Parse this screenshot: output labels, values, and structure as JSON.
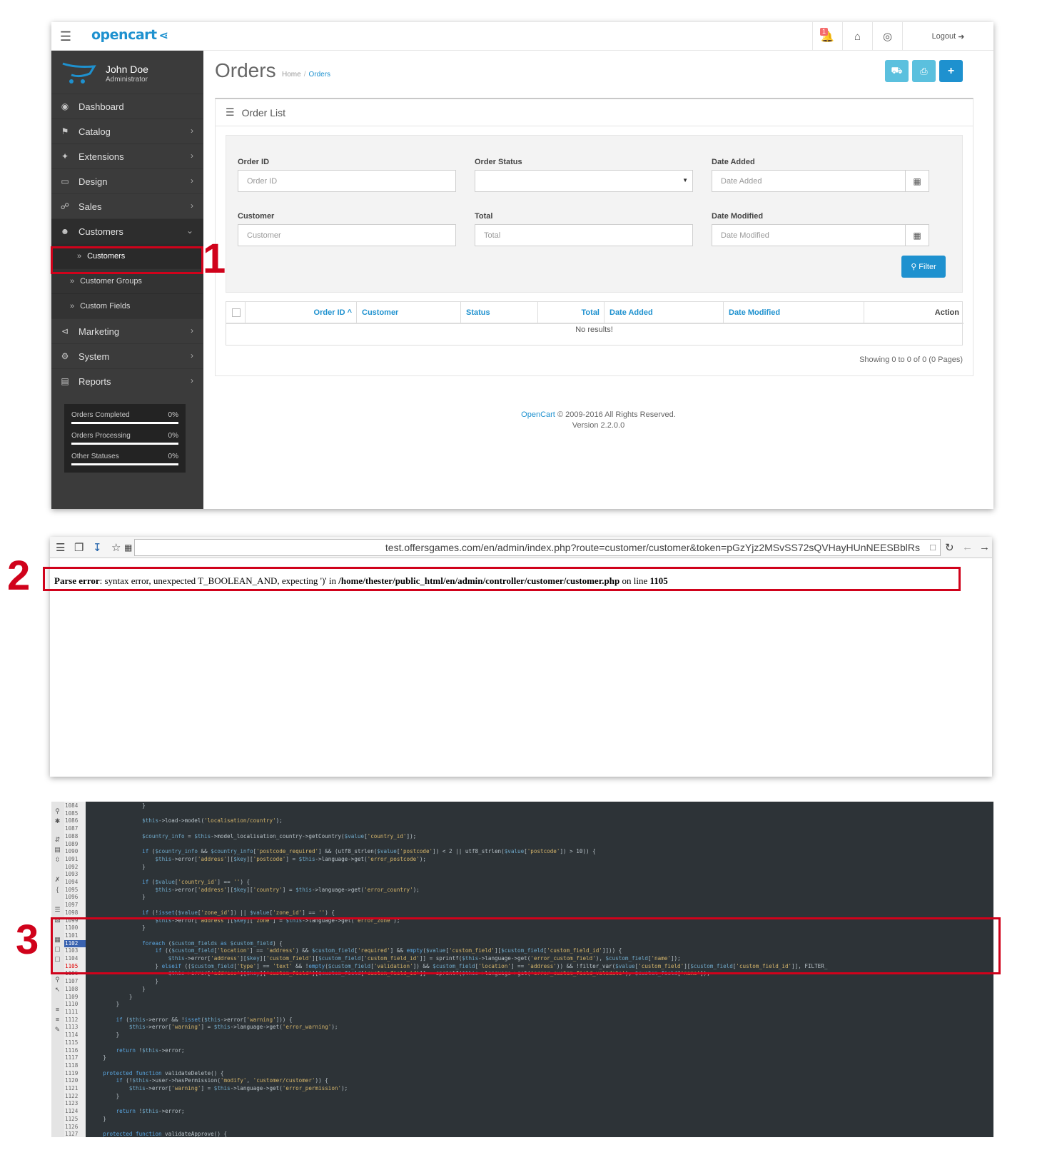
{
  "colors": {
    "brand": "#1e91cf",
    "sidebar_bg": "#3b3b3b",
    "highlight_red": "#d0021b",
    "btn_info": "#5bc0de",
    "editor_bg": "#2d3337"
  },
  "annotations": {
    "one": "1",
    "two": "2",
    "three": "3"
  },
  "opencart": {
    "logo": "opencart",
    "header": {
      "notification_count": "1",
      "logout_label": "Logout"
    },
    "profile": {
      "name": "John Doe",
      "role": "Administrator"
    },
    "nav": [
      {
        "label": "Dashboard",
        "icon": "dashboard-icon"
      },
      {
        "label": "Catalog",
        "icon": "tag-icon"
      },
      {
        "label": "Extensions",
        "icon": "puzzle-icon"
      },
      {
        "label": "Design",
        "icon": "monitor-icon"
      },
      {
        "label": "Sales",
        "icon": "cart-icon"
      },
      {
        "label": "Customers",
        "icon": "user-icon"
      },
      {
        "label": "Marketing",
        "icon": "share-icon"
      },
      {
        "label": "System",
        "icon": "cog-icon"
      },
      {
        "label": "Reports",
        "icon": "bar-chart-icon"
      }
    ],
    "subnav": [
      "Customers",
      "Customer Groups",
      "Custom Fields"
    ],
    "stats": [
      {
        "label": "Orders Completed",
        "value": "0%"
      },
      {
        "label": "Orders Processing",
        "value": "0%"
      },
      {
        "label": "Other Statuses",
        "value": "0%"
      }
    ],
    "page_title": "Orders",
    "breadcrumb": {
      "home": "Home",
      "current": "Orders"
    },
    "card_title": "Order List",
    "filters": {
      "order_id": {
        "label": "Order ID",
        "placeholder": "Order ID"
      },
      "order_status": {
        "label": "Order Status",
        "value": ""
      },
      "date_added": {
        "label": "Date Added",
        "placeholder": "Date Added"
      },
      "customer": {
        "label": "Customer",
        "placeholder": "Customer"
      },
      "total": {
        "label": "Total",
        "placeholder": "Total"
      },
      "date_modified": {
        "label": "Date Modified",
        "placeholder": "Date Modified"
      },
      "filter_button": "Filter"
    },
    "table": {
      "columns": [
        "Order ID",
        "Customer",
        "Status",
        "Total",
        "Date Added",
        "Date Modified",
        "Action"
      ],
      "sort_indicator": "^",
      "empty": "No results!"
    },
    "pagination": "Showing 0 to 0 of 0 (0 Pages)",
    "footer": {
      "link": "OpenCart",
      "copyright": "© 2009-2016 All Rights Reserved.",
      "version": "Version 2.2.0.0"
    }
  },
  "browser": {
    "url": "test.offersgames.com/en/admin/index.php?route=customer/customer&token=pGzYjz2MSvSS72sQVHayHUnNEESBblRs",
    "error": {
      "label": "Parse error",
      "message": ": syntax error, unexpected T_BOOLEAN_AND, expecting ')' in ",
      "path": "/home/thester/public_html/en/admin/controller/customer/customer.php",
      "on_line": " on line ",
      "line": "1105"
    }
  },
  "editor": {
    "line_numbers": [
      "1084",
      "1085",
      "1086",
      "1087",
      "1088",
      "1089",
      "1090",
      "1091",
      "1092",
      "1093",
      "1094",
      "1095",
      "1096",
      "1097",
      "1098",
      "1099",
      "1100",
      "1101",
      "1102",
      "1103",
      "1104",
      "1105",
      "1106",
      "1107",
      "1108",
      "1109",
      "1110",
      "1111",
      "1112",
      "1113",
      "1114",
      "1115",
      "1116",
      "1117",
      "1118",
      "1119",
      "1120",
      "1121",
      "1122",
      "1123",
      "1124",
      "1125",
      "1126",
      "1127"
    ],
    "current_line": "1102",
    "error_line": "1105",
    "lines": [
      "                }",
      "",
      "                $this->load->model('localisation/country');",
      "",
      "                $country_info = $this->model_localisation_country->getCountry($value['country_id']);",
      "",
      "                if ($country_info && $country_info['postcode_required'] && (utf8_strlen($value['postcode']) < 2 || utf8_strlen($value['postcode']) > 10)) {",
      "                    $this->error['address'][$key]['postcode'] = $this->language->get('error_postcode');",
      "                }",
      "",
      "                if ($value['country_id'] == '') {",
      "                    $this->error['address'][$key]['country'] = $this->language->get('error_country');",
      "                }",
      "",
      "                if (!isset($value['zone_id']) || $value['zone_id'] == '') {",
      "                    $this->error['address'][$key]['zone'] = $this->language->get('error_zone');",
      "                }",
      "",
      "                foreach ($custom_fields as $custom_field) {",
      "                    if (($custom_field['location'] == 'address') && $custom_field['required'] && empty($value['custom_field'][$custom_field['custom_field_id']])) {",
      "                        $this->error['address'][$key]['custom_field'][$custom_field['custom_field_id']] = sprintf($this->language->get('error_custom_field'), $custom_field['name']);",
      "                    } elseif (($custom_field['type'] == 'text' && !empty($custom_field['validation']) && $custom_field['location'] == 'address')) && !filter_var($value['custom_field'][$custom_field['custom_field_id']], FILTER_",
      "                        $this->error['address'][$key]['custom_field'][$custom_field['custom_field_id']] = sprintf($this->language->get('error_custom_field_validate'), $custom_field['name']);",
      "                    }",
      "                }",
      "            }",
      "        }",
      "",
      "        if ($this->error && !isset($this->error['warning'])) {",
      "            $this->error['warning'] = $this->language->get('error_warning');",
      "        }",
      "",
      "        return !$this->error;",
      "    }",
      "",
      "    protected function validateDelete() {",
      "        if (!$this->user->hasPermission('modify', 'customer/customer')) {",
      "            $this->error['warning'] = $this->language->get('error_permission');",
      "        }",
      "",
      "        return !$this->error;",
      "    }",
      "",
      "    protected function validateApprove() {"
    ]
  }
}
